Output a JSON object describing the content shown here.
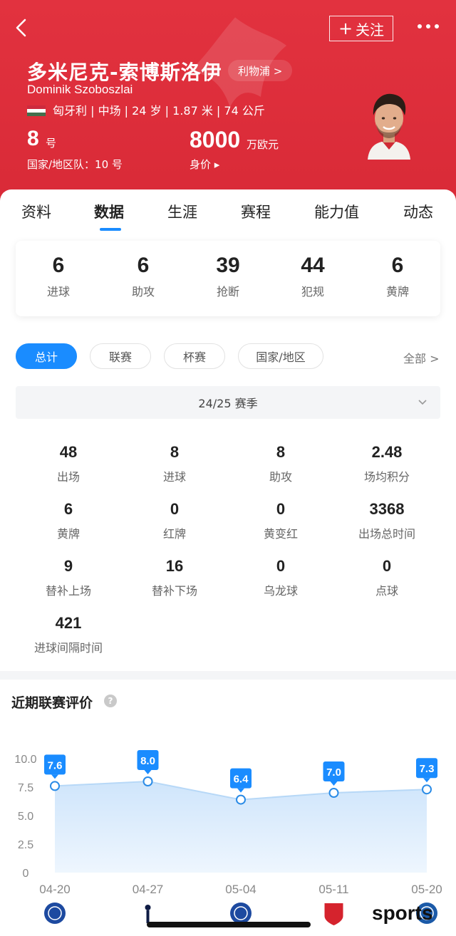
{
  "header": {
    "follow_label": "关注",
    "name_cn": "多米尼克-索博斯洛伊",
    "club": "利物浦 >",
    "name_en": "Dominik Szoboszlai",
    "meta": "匈牙利 | 中场 | 24 岁 | 1.87 米 | 74 公斤",
    "number": "8",
    "number_unit": "号",
    "national_number": "国家/地区队：10 号",
    "market_value": "8000",
    "market_value_unit": "万欧元",
    "market_value_label": "身价 ▸",
    "colors": {
      "primary": "#e2323f"
    }
  },
  "tabs": [
    "资料",
    "数据",
    "生涯",
    "赛程",
    "能力值",
    "动态"
  ],
  "active_tab": "数据",
  "summary": [
    {
      "value": "6",
      "label": "进球"
    },
    {
      "value": "6",
      "label": "助攻"
    },
    {
      "value": "39",
      "label": "抢断"
    },
    {
      "value": "44",
      "label": "犯规"
    },
    {
      "value": "6",
      "label": "黄牌"
    }
  ],
  "filters": [
    "总计",
    "联赛",
    "杯赛",
    "国家/地区"
  ],
  "filter_all": "全部 >",
  "season": "24/25 赛季",
  "stats": [
    {
      "value": "48",
      "label": "出场"
    },
    {
      "value": "8",
      "label": "进球"
    },
    {
      "value": "8",
      "label": "助攻"
    },
    {
      "value": "2.48",
      "label": "场均积分"
    },
    {
      "value": "6",
      "label": "黄牌"
    },
    {
      "value": "0",
      "label": "红牌"
    },
    {
      "value": "0",
      "label": "黄变红"
    },
    {
      "value": "3368",
      "label": "出场总时间"
    },
    {
      "value": "9",
      "label": "替补上场"
    },
    {
      "value": "16",
      "label": "替补下场"
    },
    {
      "value": "0",
      "label": "乌龙球"
    },
    {
      "value": "0",
      "label": "点球"
    },
    {
      "value": "421",
      "label": "进球间隔时间"
    }
  ],
  "chart_section": {
    "title": "近期联赛评价",
    "help": "?"
  },
  "chart_data": {
    "type": "area",
    "categories": [
      "04-20",
      "04-27",
      "05-04",
      "05-11",
      "05-20"
    ],
    "values": [
      7.6,
      8.0,
      6.4,
      7.0,
      7.3
    ],
    "y_ticks": [
      "10.0",
      "7.5",
      "5.0",
      "2.5",
      "0"
    ],
    "ylim": [
      0,
      10
    ],
    "opponent_icons": [
      "leicester-crest-icon",
      "tottenham-crest-icon",
      "chelsea-crest-icon",
      "arsenal-crest-icon",
      "crystal-palace-crest-icon"
    ],
    "colors": {
      "line": "#b7d8f7",
      "fill": "#d6eafc",
      "label": "#1a8cff"
    }
  },
  "watermark": "sports"
}
